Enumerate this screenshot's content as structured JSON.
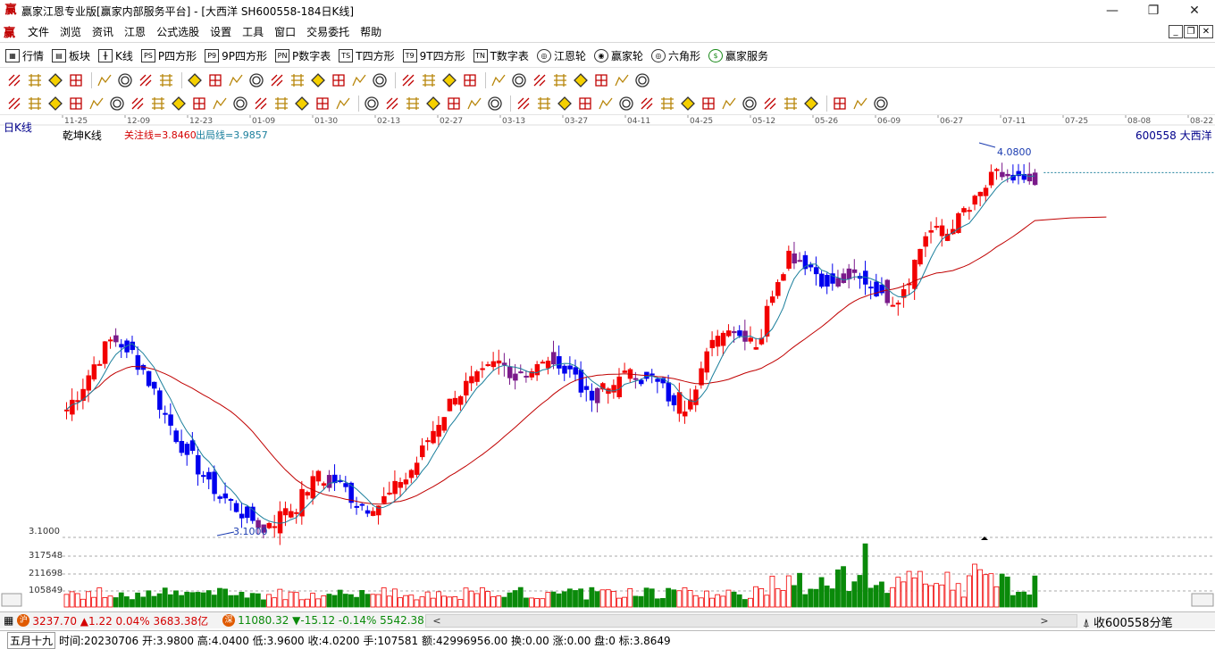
{
  "window": {
    "title": "赢家江恩专业版[赢家内部服务平台] - [大西洋  SH600558-184日K线]",
    "logo_glyph": "赢",
    "buttons": [
      "—",
      "❐",
      "✕"
    ]
  },
  "menu": {
    "items": [
      "文件",
      "浏览",
      "资讯",
      "江恩",
      "公式选股",
      "设置",
      "工具",
      "窗口",
      "交易委托",
      "帮助"
    ],
    "mdi_buttons": [
      "_",
      "❐",
      "✕"
    ]
  },
  "toolbar1": {
    "items": [
      {
        "icon": "grid-icon",
        "glyph": "▦",
        "label": "行情"
      },
      {
        "icon": "blocks-icon",
        "glyph": "▤",
        "label": "板块"
      },
      {
        "icon": "candlestick-icon",
        "glyph": "╫",
        "label": "K线"
      },
      {
        "icon": "ps-icon",
        "glyph": "PS",
        "label": "P四方形"
      },
      {
        "icon": "p9-icon",
        "glyph": "P9",
        "label": "9P四方形"
      },
      {
        "icon": "pn-icon",
        "glyph": "PN",
        "label": "P数字表"
      },
      {
        "icon": "ts-icon",
        "glyph": "TS",
        "label": "T四方形"
      },
      {
        "icon": "t9-icon",
        "glyph": "T9",
        "label": "9T四方形"
      },
      {
        "icon": "tn-icon",
        "glyph": "TN",
        "label": "T数字表"
      },
      {
        "icon": "wheel-icon",
        "glyph": "◎",
        "label": "江恩轮"
      },
      {
        "icon": "winner-wheel-icon",
        "glyph": "◉",
        "label": "赢家轮"
      },
      {
        "icon": "hexagon-icon",
        "glyph": "◎",
        "label": "六角形"
      },
      {
        "icon": "dollar-icon",
        "glyph": "$",
        "label": "赢家服务"
      }
    ]
  },
  "chart": {
    "timeframe_label": "日K线",
    "indicator_name": "乾坤K线",
    "guanzhu_line": "关注线=3.8460",
    "chuju_line": "出局线=3.9857",
    "stock_label": "600558  大西洋",
    "high_marker": "4.0800",
    "low_marker": "3.1000",
    "price_axis_label": "3.1000",
    "volume_axis_labels": [
      "317548",
      "211698",
      "105849"
    ],
    "colors": {
      "up_red": "#f20000",
      "down_blue": "#0000ee",
      "purple": "#7a1a8a",
      "volume_green": "#0a8a0a",
      "ma_red": "#c00000",
      "ma_teal": "#1b7f9c"
    }
  },
  "chart_data": {
    "type": "candlestick",
    "x_ticks": [
      "11-25",
      "12-09",
      "12-23",
      "01-09",
      "01-30",
      "02-13",
      "02-27",
      "03-13",
      "03-27",
      "04-11",
      "04-25",
      "05-12",
      "05-26",
      "06-09",
      "06-27",
      "07-11",
      "07-25",
      "08-08",
      "08-22"
    ],
    "price_range": [
      3.1,
      4.08
    ],
    "close_path": [
      3.42,
      3.48,
      3.55,
      3.6,
      3.58,
      3.52,
      3.44,
      3.36,
      3.3,
      3.25,
      3.2,
      3.17,
      3.14,
      3.12,
      3.15,
      3.18,
      3.23,
      3.25,
      3.22,
      3.18,
      3.17,
      3.2,
      3.24,
      3.3,
      3.38,
      3.44,
      3.48,
      3.5,
      3.54,
      3.52,
      3.52,
      3.53,
      3.55,
      3.52,
      3.44,
      3.47,
      3.49,
      3.52,
      3.5,
      3.46,
      3.42,
      3.5,
      3.58,
      3.63,
      3.62,
      3.58,
      3.74,
      3.82,
      3.8,
      3.76,
      3.74,
      3.76,
      3.75,
      3.72,
      3.7,
      3.78,
      3.88,
      3.86,
      3.9,
      3.94,
      4.0,
      4.02,
      4.0,
      4.0
    ],
    "volume_axis": [
      105849,
      211698,
      317548
    ]
  },
  "index_bar": {
    "sh_badge": "沪",
    "sh_text": "3237.70 ▲1.22 0.04% 3683.38亿",
    "sz_badge": "深",
    "sz_text": "11080.32 ▼-15.12 -0.14% 5542.38",
    "scroll_left": "<",
    "scroll_right": ">",
    "command": "收600558分笔"
  },
  "status_bar": {
    "lunar": "五月十九",
    "text": "时间:20230706 开:3.9800 高:4.0400 低:3.9600 收:4.0200 手:107581 额:42996956.00 换:0.00 涨:0.00 盘:0 标:3.8649"
  }
}
